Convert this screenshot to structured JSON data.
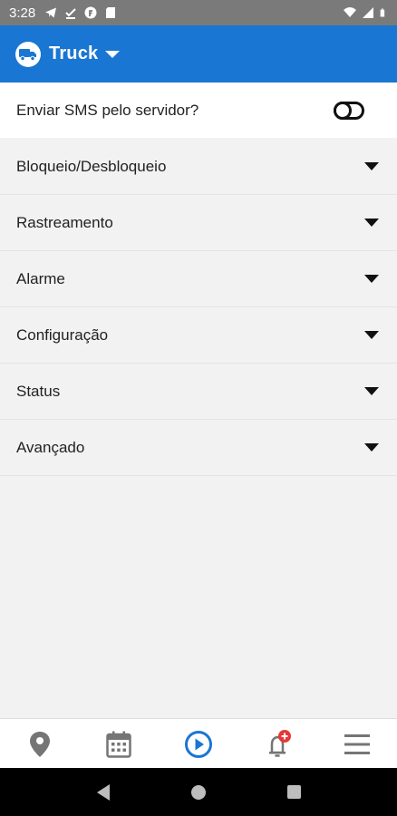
{
  "status_bar": {
    "time": "3:28",
    "icons_left": [
      "telegram-icon",
      "download-done-icon",
      "f-app-icon",
      "sd-card-icon"
    ],
    "icons_right": [
      "wifi-icon",
      "signal-icon",
      "battery-icon"
    ]
  },
  "app_bar": {
    "title": "Truck",
    "accent_color": "#1976d2"
  },
  "sms_toggle": {
    "label": "Enviar SMS pelo servidor?",
    "checked": false
  },
  "menu": {
    "items": [
      {
        "label": "Bloqueio/Desbloqueio"
      },
      {
        "label": "Rastreamento"
      },
      {
        "label": "Alarme"
      },
      {
        "label": "Configuração"
      },
      {
        "label": "Status"
      },
      {
        "label": "Avançado"
      }
    ]
  },
  "bottom_nav": {
    "items": [
      {
        "icon": "map-pin-icon"
      },
      {
        "icon": "calendar-icon"
      },
      {
        "icon": "play-circle-icon",
        "active": true
      },
      {
        "icon": "bell-icon",
        "badge": "+"
      },
      {
        "icon": "menu-icon"
      }
    ],
    "active_color": "#1976d2"
  },
  "system_nav": [
    "back-icon",
    "home-icon",
    "recents-icon"
  ]
}
